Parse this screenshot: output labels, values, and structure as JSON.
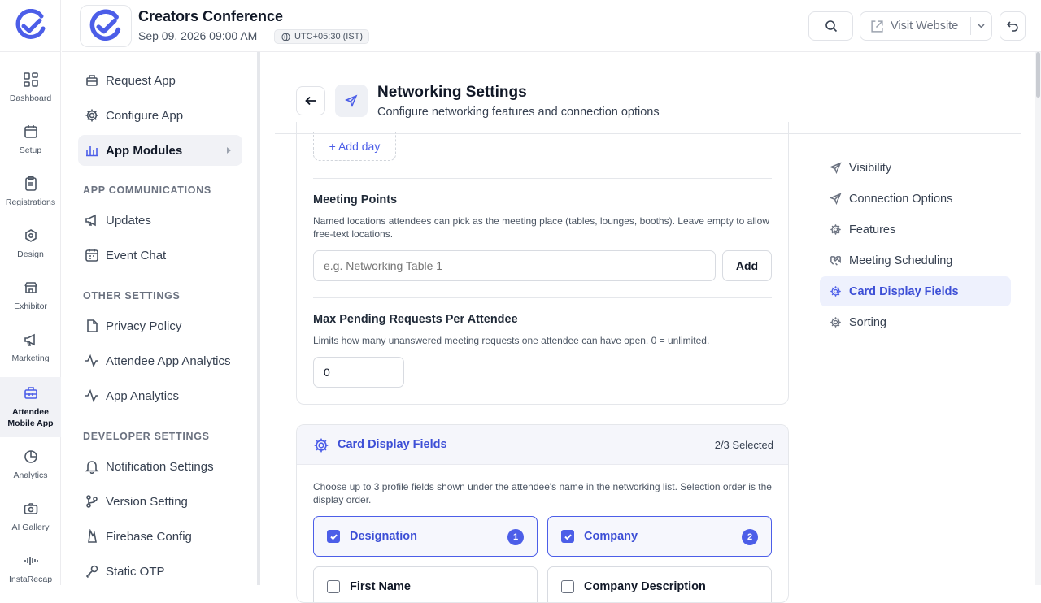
{
  "rail": {
    "items": [
      {
        "label": "Dashboard",
        "icon": "grid-icon"
      },
      {
        "label": "Setup",
        "icon": "calendar-icon"
      },
      {
        "label": "Registrations",
        "icon": "clipboard-icon"
      },
      {
        "label": "Design",
        "icon": "palette-icon"
      },
      {
        "label": "Exhibitor",
        "icon": "store-icon"
      },
      {
        "label": "Marketing",
        "icon": "megaphone-icon"
      },
      {
        "label": "Attendee Mobile App",
        "icon": "mobile-app-icon"
      },
      {
        "label": "Analytics",
        "icon": "pie-chart-icon"
      },
      {
        "label": "AI Gallery",
        "icon": "camera-icon"
      },
      {
        "label": "InstaRecap",
        "icon": "waveform-icon"
      }
    ]
  },
  "event": {
    "title": "Creators Conference",
    "date": "Sep 09, 2026 09:00 AM",
    "timezone": "UTC+05:30 (IST)"
  },
  "topbar": {
    "visit_label": "Visit Website"
  },
  "sidebar": {
    "top": [
      {
        "label": "Request App",
        "icon": "package-icon"
      },
      {
        "label": "Configure App",
        "icon": "gear-icon"
      },
      {
        "label": "App Modules",
        "icon": "bar-chart-icon"
      }
    ],
    "sections": [
      {
        "title": "APP COMMUNICATIONS",
        "items": [
          {
            "label": "Updates",
            "icon": "megaphone-icon"
          },
          {
            "label": "Event Chat",
            "icon": "calendar-icon"
          }
        ]
      },
      {
        "title": "OTHER SETTINGS",
        "items": [
          {
            "label": "Privacy Policy",
            "icon": "document-icon"
          },
          {
            "label": "Attendee App Analytics",
            "icon": "activity-icon"
          },
          {
            "label": "App Analytics",
            "icon": "activity-icon"
          }
        ]
      },
      {
        "title": "DEVELOPER SETTINGS",
        "items": [
          {
            "label": "Notification Settings",
            "icon": "bell-icon"
          },
          {
            "label": "Version Setting",
            "icon": "branch-icon"
          },
          {
            "label": "Firebase Config",
            "icon": "flame-icon"
          },
          {
            "label": "Static OTP",
            "icon": "key-icon"
          }
        ]
      }
    ]
  },
  "page": {
    "title": "Networking Settings",
    "subtitle": "Configure networking features and connection options"
  },
  "form": {
    "add_day": "+ Add day",
    "meeting_points": {
      "label": "Meeting Points",
      "help": "Named locations attendees can pick as the meeting place (tables, lounges, booths). Leave empty to allow free-text locations.",
      "placeholder": "e.g. Networking Table 1",
      "add_label": "Add"
    },
    "max_pending": {
      "label": "Max Pending Requests Per Attendee",
      "help": "Limits how many unanswered meeting requests one attendee can have open. 0 = unlimited.",
      "value": "0"
    }
  },
  "card_display": {
    "title": "Card Display Fields",
    "count": "2/3 Selected",
    "help": "Choose up to 3 profile fields shown under the attendee's name in the networking list. Selection order is the display order.",
    "options": [
      {
        "label": "Designation",
        "checked": true,
        "order": "1"
      },
      {
        "label": "Company",
        "checked": true,
        "order": "2"
      },
      {
        "label": "First Name",
        "checked": false
      },
      {
        "label": "Company Description",
        "checked": false
      }
    ]
  },
  "toc": [
    {
      "label": "Visibility",
      "icon": "send-icon"
    },
    {
      "label": "Connection Options",
      "icon": "send-icon"
    },
    {
      "label": "Features",
      "icon": "gear-icon"
    },
    {
      "label": "Meeting Scheduling",
      "icon": "handshake-icon"
    },
    {
      "label": "Card Display Fields",
      "icon": "gear-icon",
      "active": true
    },
    {
      "label": "Sorting",
      "icon": "gear-icon"
    }
  ],
  "colors": {
    "accent": "#4c5ee8",
    "accent_bg": "#eef1fd"
  }
}
